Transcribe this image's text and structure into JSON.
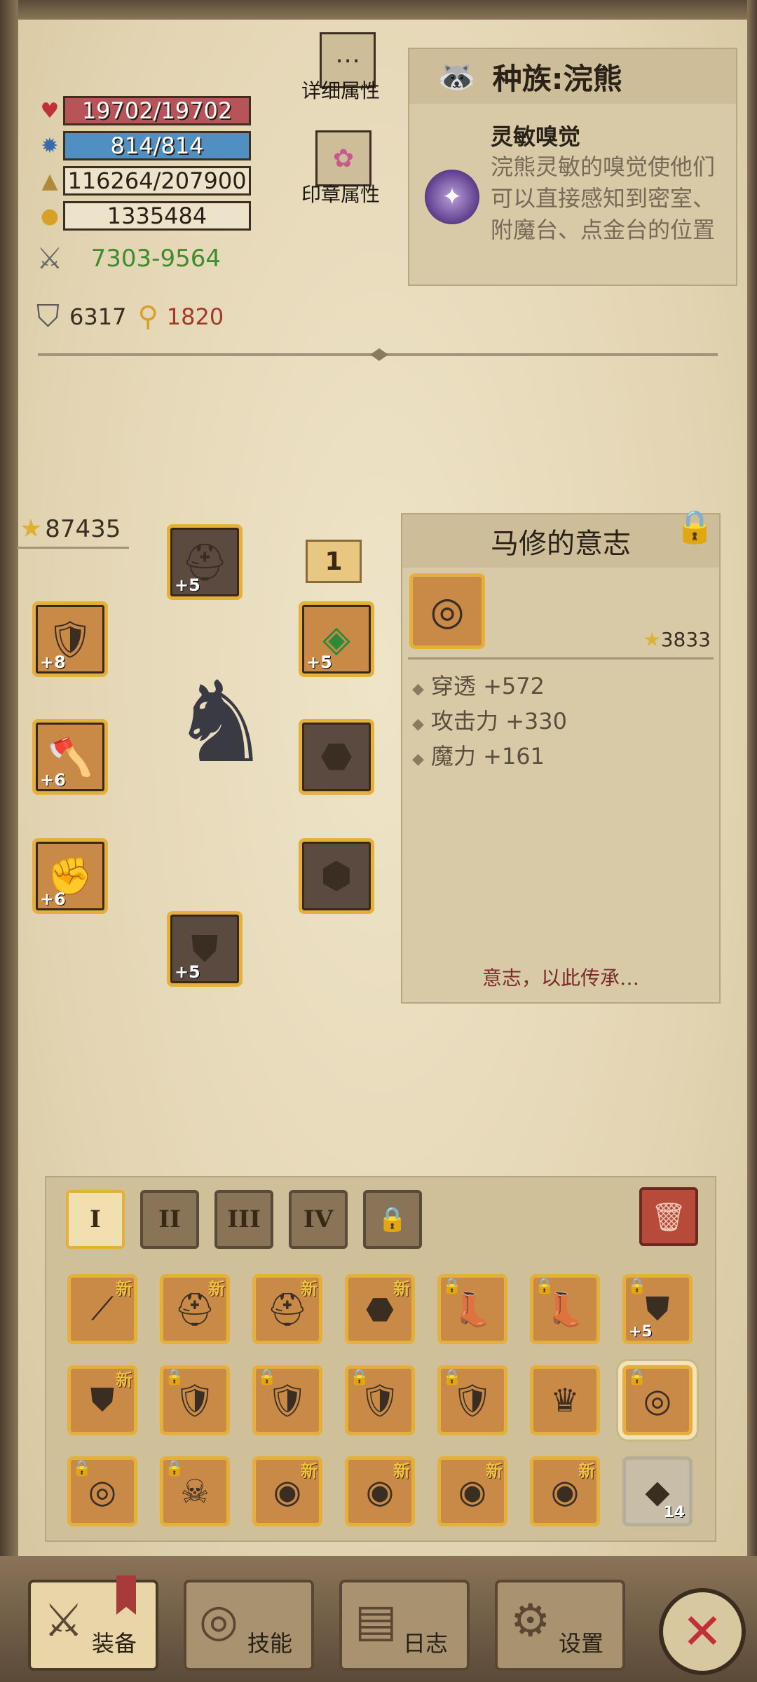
{
  "stats": {
    "hp": "19702/19702",
    "mp": "814/814",
    "xp": "116264/207900",
    "gold": "1335484",
    "attack": "7303-9564",
    "defense": "6317",
    "magic": "1820"
  },
  "side_buttons": {
    "detail_label": "详细属性",
    "seal_label": "印章属性"
  },
  "race": {
    "title": "种族:浣熊",
    "trait_title": "灵敏嗅觉",
    "trait_desc": "浣熊灵敏的嗅觉使他们可以直接感知到密室、附魔台、点金台的位置"
  },
  "equipment": {
    "power": "87435",
    "level": "1",
    "slots": [
      {
        "icon": "helmet-icon",
        "plus": "+5"
      },
      {
        "icon": "bracer-icon",
        "plus": "+8"
      },
      {
        "icon": "axe-icon",
        "plus": "+6"
      },
      {
        "icon": "gauntlet-icon",
        "plus": "+6"
      },
      {
        "icon": "necklace-icon",
        "plus": "+5"
      },
      {
        "icon": "shoulder-icon",
        "plus": ""
      },
      {
        "icon": "chest-armor-icon",
        "plus": ""
      },
      {
        "icon": "leg-armor-icon",
        "plus": "+5"
      }
    ]
  },
  "item_detail": {
    "name": "马修的意志",
    "power": "3833",
    "attributes": [
      "穿透 +572",
      "攻击力 +330",
      "魔力 +161"
    ],
    "quote": "意志，以此传承…"
  },
  "inventory": {
    "tabs": [
      "I",
      "II",
      "III",
      "IV"
    ],
    "new_badge": "新",
    "items": [
      {
        "icon": "spear-icon",
        "new": true,
        "locked": false,
        "plus": "",
        "count": ""
      },
      {
        "icon": "helmet-icon",
        "new": true,
        "locked": false,
        "plus": "",
        "count": ""
      },
      {
        "icon": "helmet-icon",
        "new": true,
        "locked": false,
        "plus": "",
        "count": ""
      },
      {
        "icon": "shoulder-icon",
        "new": true,
        "locked": false,
        "plus": "",
        "count": ""
      },
      {
        "icon": "boots-icon",
        "new": false,
        "locked": true,
        "plus": "",
        "count": ""
      },
      {
        "icon": "boots-icon",
        "new": false,
        "locked": true,
        "plus": "",
        "count": ""
      },
      {
        "icon": "armor-icon",
        "new": false,
        "locked": true,
        "plus": "+5",
        "count": ""
      },
      {
        "icon": "leg-armor-icon",
        "new": true,
        "locked": false,
        "plus": "",
        "count": ""
      },
      {
        "icon": "bracer-icon",
        "new": false,
        "locked": true,
        "plus": "",
        "count": ""
      },
      {
        "icon": "bracer-icon",
        "new": false,
        "locked": true,
        "plus": "",
        "count": ""
      },
      {
        "icon": "bracer-icon",
        "new": false,
        "locked": true,
        "plus": "",
        "count": ""
      },
      {
        "icon": "bracer-icon",
        "new": false,
        "locked": true,
        "plus": "",
        "count": ""
      },
      {
        "icon": "crown-icon",
        "new": false,
        "locked": false,
        "plus": "",
        "count": ""
      },
      {
        "icon": "ring-icon",
        "new": false,
        "locked": true,
        "plus": "",
        "count": "",
        "selected": true
      },
      {
        "icon": "ring-icon",
        "new": false,
        "locked": true,
        "plus": "",
        "count": ""
      },
      {
        "icon": "mask-icon",
        "new": false,
        "locked": true,
        "plus": "",
        "count": ""
      },
      {
        "icon": "eye-shield-icon",
        "new": true,
        "locked": false,
        "plus": "",
        "count": ""
      },
      {
        "icon": "eye-shield-icon",
        "new": true,
        "locked": false,
        "plus": "",
        "count": ""
      },
      {
        "icon": "eye-shield-icon",
        "new": true,
        "locked": false,
        "plus": "",
        "count": ""
      },
      {
        "icon": "eye-shield-icon",
        "new": true,
        "locked": false,
        "plus": "",
        "count": ""
      },
      {
        "icon": "crystal-icon",
        "new": false,
        "locked": false,
        "plus": "",
        "count": "14",
        "gray": true
      }
    ]
  },
  "nav": {
    "equip": "装备",
    "skills": "技能",
    "log": "日志",
    "settings": "设置"
  }
}
